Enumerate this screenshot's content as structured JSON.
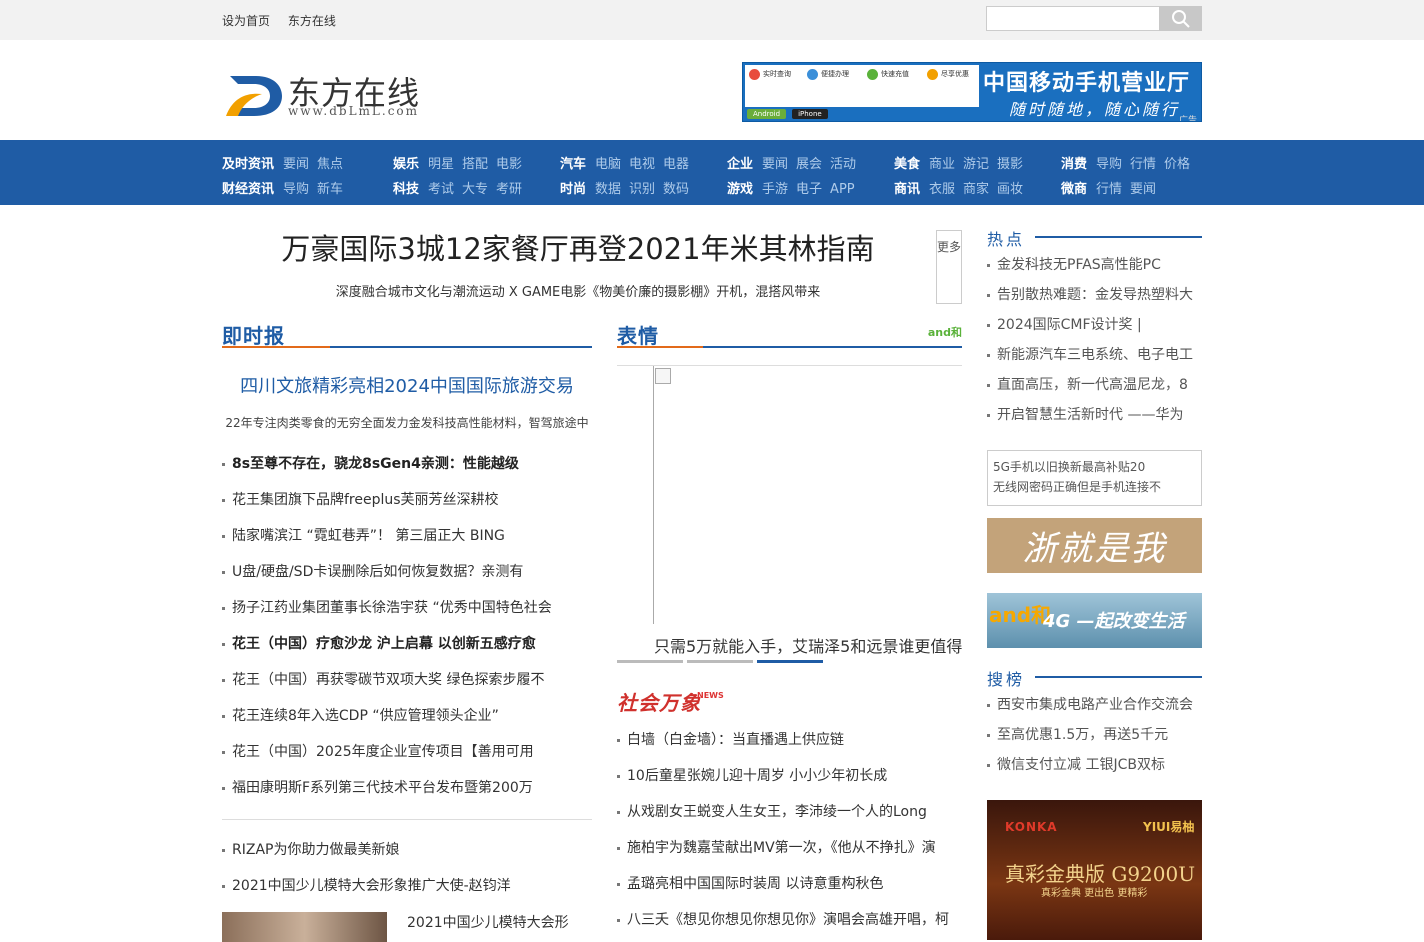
{
  "topbar": {
    "links": [
      "设为首页",
      "东方在线"
    ],
    "search_placeholder": ""
  },
  "logo": {
    "name": "东方在线",
    "url": "www.dbLmL.com"
  },
  "ad_top": {
    "features": [
      "实时查询",
      "便捷办理",
      "快速充值",
      "尽享优惠"
    ],
    "apps": [
      "Android",
      "iPhone"
    ],
    "title": "中国移动手机营业厅",
    "slogan": "随时随地，随心随行",
    "tag": "广告"
  },
  "nav": {
    "groups": [
      {
        "rows": [
          {
            "main": "及时资讯",
            "subs": [
              "要闻",
              "焦点"
            ]
          },
          {
            "main": "财经资讯",
            "subs": [
              "导购",
              "新车"
            ]
          }
        ]
      },
      {
        "rows": [
          {
            "main": "娱乐",
            "subs": [
              "明星",
              "搭配",
              "电影"
            ]
          },
          {
            "main": "科技",
            "subs": [
              "考试",
              "大专",
              "考研"
            ]
          }
        ]
      },
      {
        "rows": [
          {
            "main": "汽车",
            "subs": [
              "电脑",
              "电视",
              "电器"
            ]
          },
          {
            "main": "时尚",
            "subs": [
              "数据",
              "识别",
              "数码"
            ]
          }
        ]
      },
      {
        "rows": [
          {
            "main": "企业",
            "subs": [
              "要闻",
              "展会",
              "活动"
            ]
          },
          {
            "main": "游戏",
            "subs": [
              "手游",
              "电子",
              "APP"
            ]
          }
        ]
      },
      {
        "rows": [
          {
            "main": "美食",
            "subs": [
              "商业",
              "游记",
              "摄影"
            ]
          },
          {
            "main": "商讯",
            "subs": [
              "衣服",
              "商家",
              "画妆"
            ]
          }
        ]
      },
      {
        "rows": [
          {
            "main": "消费",
            "subs": [
              "导购",
              "行情",
              "价格"
            ]
          },
          {
            "main": "微商",
            "subs": [
              "行情",
              "要闻"
            ]
          }
        ]
      }
    ]
  },
  "headline": {
    "title": "万豪国际3城12家餐厅再登2021年米其林指南",
    "subtitle": "深度融合城市文化与潮流运动 X GAME电影《物美价廉的摄影棚》开机，混搭风带来",
    "more": "更多"
  },
  "instant": {
    "title": "即时报",
    "feature_title": "四川文旅精彩亮相2024中国国际旅游交易",
    "feature_sub": "22年专注肉类零食的无穷全面发力金发科技高性能材料，智驾旅途中",
    "items": [
      {
        "text": "8s至尊不存在，骁龙8sGen4亲测：性能越级",
        "bold": true
      },
      {
        "text": "花王集团旗下品牌freeplus芙丽芳丝深耕校",
        "bold": false
      },
      {
        "text": "陆家嘴滨江 “霓虹巷弄”！ 第三届正大 BING",
        "bold": false
      },
      {
        "text": "U盘/硬盘/SD卡误删除后如何恢复数据？亲测有",
        "bold": false
      },
      {
        "text": "扬子江药业集团董事长徐浩宇获 “优秀中国特色社会",
        "bold": false
      },
      {
        "text": "花王（中国）疗愈沙龙 沪上启幕 以创新五感疗愈",
        "bold": true
      },
      {
        "text": "花王（中国）再获零碳节双项大奖 绿色探索步履不",
        "bold": false
      },
      {
        "text": "花王连续8年入选CDP “供应管理领头企业”",
        "bold": false
      },
      {
        "text": "花王（中国）2025年度企业宣传项目【善用可用",
        "bold": false
      },
      {
        "text": "福田康明斯F系列第三代技术平台发布暨第200万",
        "bold": false
      }
    ],
    "items2": [
      "RIZAP为你助力做最美新娘",
      "2021中国少儿模特大会形象推广大使-赵钧洋"
    ],
    "thumb_caption": "2021中国少儿模特大会形"
  },
  "expression": {
    "title": "表情",
    "caption": "只需5万就能入手，艾瑞泽5和远景谁更值得",
    "brand": "and和"
  },
  "society": {
    "title": "社会万象",
    "tag": "NEWS",
    "items": [
      "白墙（白金墙）：当直播遇上供应链",
      "10后童星张婉儿迎十周岁 小小少年初长成",
      "从戏剧女王蜕变人生女王，李沛绫一个人的Long",
      "施柏宇为魏嘉莹献出MV第一次，《他从不挣扎》演",
      "孟璐亮相中国国际时装周 以诗意重构秋色",
      "八三夭《想见你想见你想见你》演唱会高雄开唱，柯"
    ]
  },
  "hot": {
    "title": "热点",
    "items": [
      "金发科技无PFAS高性能PC",
      "告别散热难题：金发导热塑料大",
      "2024国际CMF设计奖 |",
      "新能源汽车三电系统、电子电工",
      "直面高压，新一代高温尼龙，8",
      "开启智慧生活新时代 ——华为"
    ],
    "box": [
      "5G手机以旧换新最高补贴20",
      "无线网密码正确但是手机连接不"
    ]
  },
  "side_ads": {
    "zhejiang": "浙就是我",
    "and4g_left": "and和",
    "and4g_right": "4G —起改变生活",
    "konka": "KONKA",
    "yiui": "YIUI易柚",
    "konka_model": "真彩金典版 G9200U",
    "konka_sub": "真彩金典 更出色 更精彩"
  },
  "search_rank": {
    "title": "搜榜",
    "items": [
      "西安市集成电路产业合作交流会",
      "至高优惠1.5万，再送5千元",
      "微信支付立减 工银JCB双标"
    ]
  },
  "colors": {
    "nav_bg": "#1f5ca5",
    "accent": "#e26a1a",
    "title_blue": "#1f5ca5"
  }
}
